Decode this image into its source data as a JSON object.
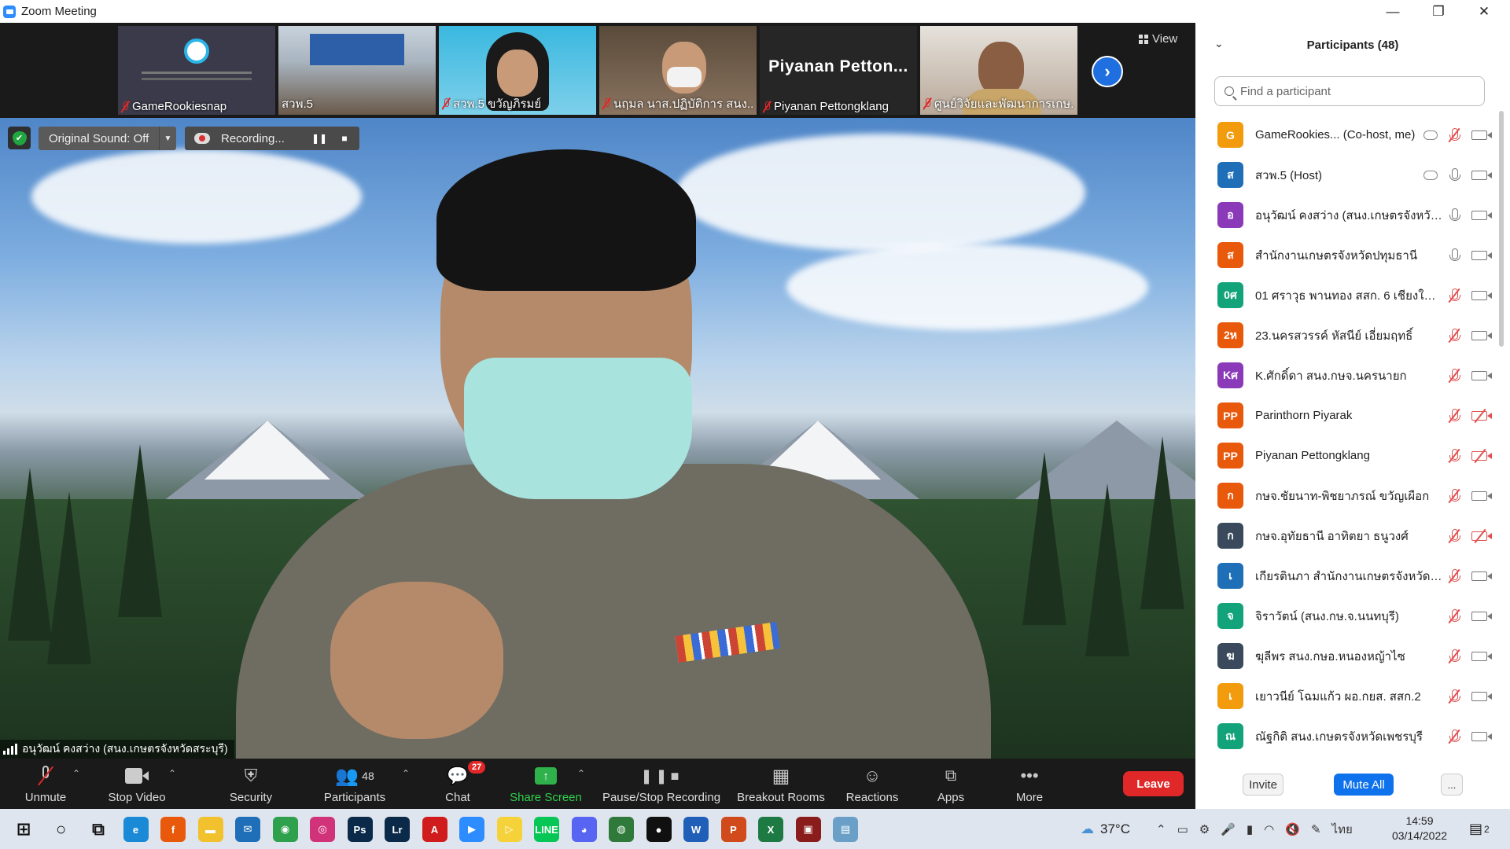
{
  "window": {
    "title": "Zoom Meeting",
    "controls": [
      "—",
      "❐",
      "✕"
    ]
  },
  "thumbnails": [
    {
      "name": "GameRookiesnap",
      "muted": true,
      "style": "logo"
    },
    {
      "name": "สวพ.5",
      "muted": false,
      "style": "room"
    },
    {
      "name": "สวพ.5 ขวัญภิรมย์",
      "muted": true,
      "style": "person"
    },
    {
      "name": "นฤมล นาส.ปฏิบัติการ สนง...",
      "muted": true,
      "style": "person"
    },
    {
      "name": "Piyanan Pettongklang",
      "muted": true,
      "style": "text",
      "display_text": "Piyanan  Petton..."
    },
    {
      "name": "ศูนย์วิจัยและพัฒนาการเกษ...",
      "muted": true,
      "style": "person"
    }
  ],
  "view_button": "View",
  "overlay": {
    "original_sound": "Original Sound: Off",
    "recording": "Recording..."
  },
  "active_speaker": "อนุวัฒน์ คงสว่าง (สนง.เกษตรจังหวัดสระบุรี)",
  "toolbar": {
    "unmute": "Unmute",
    "stop_video": "Stop Video",
    "security": "Security",
    "participants": "Participants",
    "participants_count": "48",
    "chat": "Chat",
    "chat_badge": "27",
    "share_screen": "Share Screen",
    "pause_stop_recording": "Pause/Stop Recording",
    "breakout_rooms": "Breakout Rooms",
    "reactions": "Reactions",
    "apps": "Apps",
    "more": "More",
    "leave": "Leave"
  },
  "panel": {
    "title": "Participants (48)",
    "search_placeholder": "Find a participant",
    "invite": "Invite",
    "mute_all": "Mute All",
    "more": "...",
    "participants": [
      {
        "initials": "G",
        "color": "#f29b0c",
        "name": "GameRookies...  (Co-host, me)",
        "cloud": true,
        "mic": "muted",
        "cam": "on"
      },
      {
        "initials": "ส",
        "color": "#1f6fb8",
        "name": "สวพ.5 (Host)",
        "cloud": true,
        "mic": "on",
        "cam": "on"
      },
      {
        "initials": "อ",
        "color": "#8a3ab9",
        "name": "อนุวัฒน์ คงสว่าง (สนง.เกษตรจังหวัดสร...",
        "cloud": false,
        "mic": "on",
        "cam": "on"
      },
      {
        "initials": "ส",
        "color": "#e8590c",
        "name": "สำนักงานเกษตรจังหวัดปทุมธานี",
        "cloud": false,
        "mic": "on",
        "cam": "on"
      },
      {
        "initials": "0ศ",
        "color": "#13a37a",
        "name": "01 ศราวุธ พานทอง สสก. 6 เชียงใหม่ ก...",
        "cloud": false,
        "mic": "muted",
        "cam": "on"
      },
      {
        "initials": "2ห",
        "color": "#e8590c",
        "name": "23.นครสวรรค์ หัสนีย์  เอี่ยมฤทธิ์",
        "cloud": false,
        "mic": "muted",
        "cam": "on"
      },
      {
        "initials": "Kศ",
        "color": "#8a3ab9",
        "name": "K.ศักดิ์ดา  สนง.กษจ.นครนายก",
        "cloud": false,
        "mic": "muted",
        "cam": "on"
      },
      {
        "initials": "PP",
        "color": "#e8590c",
        "name": "Parinthorn Piyarak",
        "cloud": false,
        "mic": "muted",
        "cam": "off"
      },
      {
        "initials": "PP",
        "color": "#e8590c",
        "name": "Piyanan Pettongklang",
        "cloud": false,
        "mic": "muted",
        "cam": "off"
      },
      {
        "initials": "ก",
        "color": "#e8590c",
        "name": "กษจ.ชัยนาท-พิชยาภรณ์  ขวัญเผือก",
        "cloud": false,
        "mic": "muted",
        "cam": "on"
      },
      {
        "initials": "ก",
        "color": "#3a4a5c",
        "name": "กษจ.อุทัยธานี อาทิตยา ธนูวงศ์",
        "cloud": false,
        "mic": "muted",
        "cam": "off"
      },
      {
        "initials": "เ",
        "color": "#1f6fb8",
        "name": "เกียรตินภา สำนักงานเกษตรจังหวัดสมุท...",
        "cloud": false,
        "mic": "muted",
        "cam": "on"
      },
      {
        "initials": "จ",
        "color": "#13a37a",
        "name": "จิราวัตน์ (สนง.กษ.จ.นนทบุรี)",
        "cloud": false,
        "mic": "muted",
        "cam": "on"
      },
      {
        "initials": "ฆ",
        "color": "#3a4a5c",
        "name": "ฆุลีพร สนง.กษอ.หนองหญ้าไซ",
        "cloud": false,
        "mic": "muted",
        "cam": "on"
      },
      {
        "initials": "เ",
        "color": "#f29b0c",
        "name": "เยาวนีย์ โฉมแก้ว ผอ.กยส. สสก.2",
        "cloud": false,
        "mic": "muted",
        "cam": "on"
      },
      {
        "initials": "ณ",
        "color": "#13a37a",
        "name": "ณัฐกิติ สนง.เกษตรจังหวัดเพชรบุรี",
        "cloud": false,
        "mic": "muted",
        "cam": "on"
      }
    ]
  },
  "taskbar": {
    "weather": "37°C",
    "language": "ไทย",
    "time": "14:59",
    "date": "03/14/2022",
    "notifications": "2",
    "apps": [
      {
        "icon": "windows-start-icon",
        "label": "⊞",
        "color": "transparent"
      },
      {
        "icon": "cortana-icon",
        "label": "○",
        "color": "transparent"
      },
      {
        "icon": "task-view-icon",
        "label": "⧉",
        "color": "transparent"
      },
      {
        "icon": "edge-icon",
        "label": "e",
        "color": "#1b8ad6"
      },
      {
        "icon": "firefox-icon",
        "label": "f",
        "color": "#e8590c"
      },
      {
        "icon": "file-explorer-icon",
        "label": "▬",
        "color": "#f2c12e"
      },
      {
        "icon": "mail-icon",
        "label": "✉",
        "color": "#1f6fb8"
      },
      {
        "icon": "chrome-icon",
        "label": "◉",
        "color": "#2fa04b"
      },
      {
        "icon": "instagram-icon",
        "label": "◎",
        "color": "#d1337a"
      },
      {
        "icon": "photoshop-icon",
        "label": "Ps",
        "color": "#0b2a4a"
      },
      {
        "icon": "lightroom-icon",
        "label": "Lr",
        "color": "#0b2a4a"
      },
      {
        "icon": "acrobat-icon",
        "label": "A",
        "color": "#d01c1c"
      },
      {
        "icon": "zoom-icon",
        "label": "▶",
        "color": "#2d8cff"
      },
      {
        "icon": "player-icon",
        "label": "▷",
        "color": "#f5d23a"
      },
      {
        "icon": "line-icon",
        "label": "LINE",
        "color": "#06c755"
      },
      {
        "icon": "discord-icon",
        "label": "◕",
        "color": "#5865f2"
      },
      {
        "icon": "maps-icon",
        "label": "◍",
        "color": "#2f7a3a"
      },
      {
        "icon": "obs-icon",
        "label": "●",
        "color": "#101010"
      },
      {
        "icon": "word-icon",
        "label": "W",
        "color": "#1f5fb8"
      },
      {
        "icon": "powerpoint-icon",
        "label": "P",
        "color": "#d04a1c"
      },
      {
        "icon": "excel-icon",
        "label": "X",
        "color": "#1d7a43"
      },
      {
        "icon": "game-icon",
        "label": "▣",
        "color": "#8a1c1c"
      },
      {
        "icon": "photos-icon",
        "label": "▤",
        "color": "#6aa0c8"
      }
    ]
  }
}
